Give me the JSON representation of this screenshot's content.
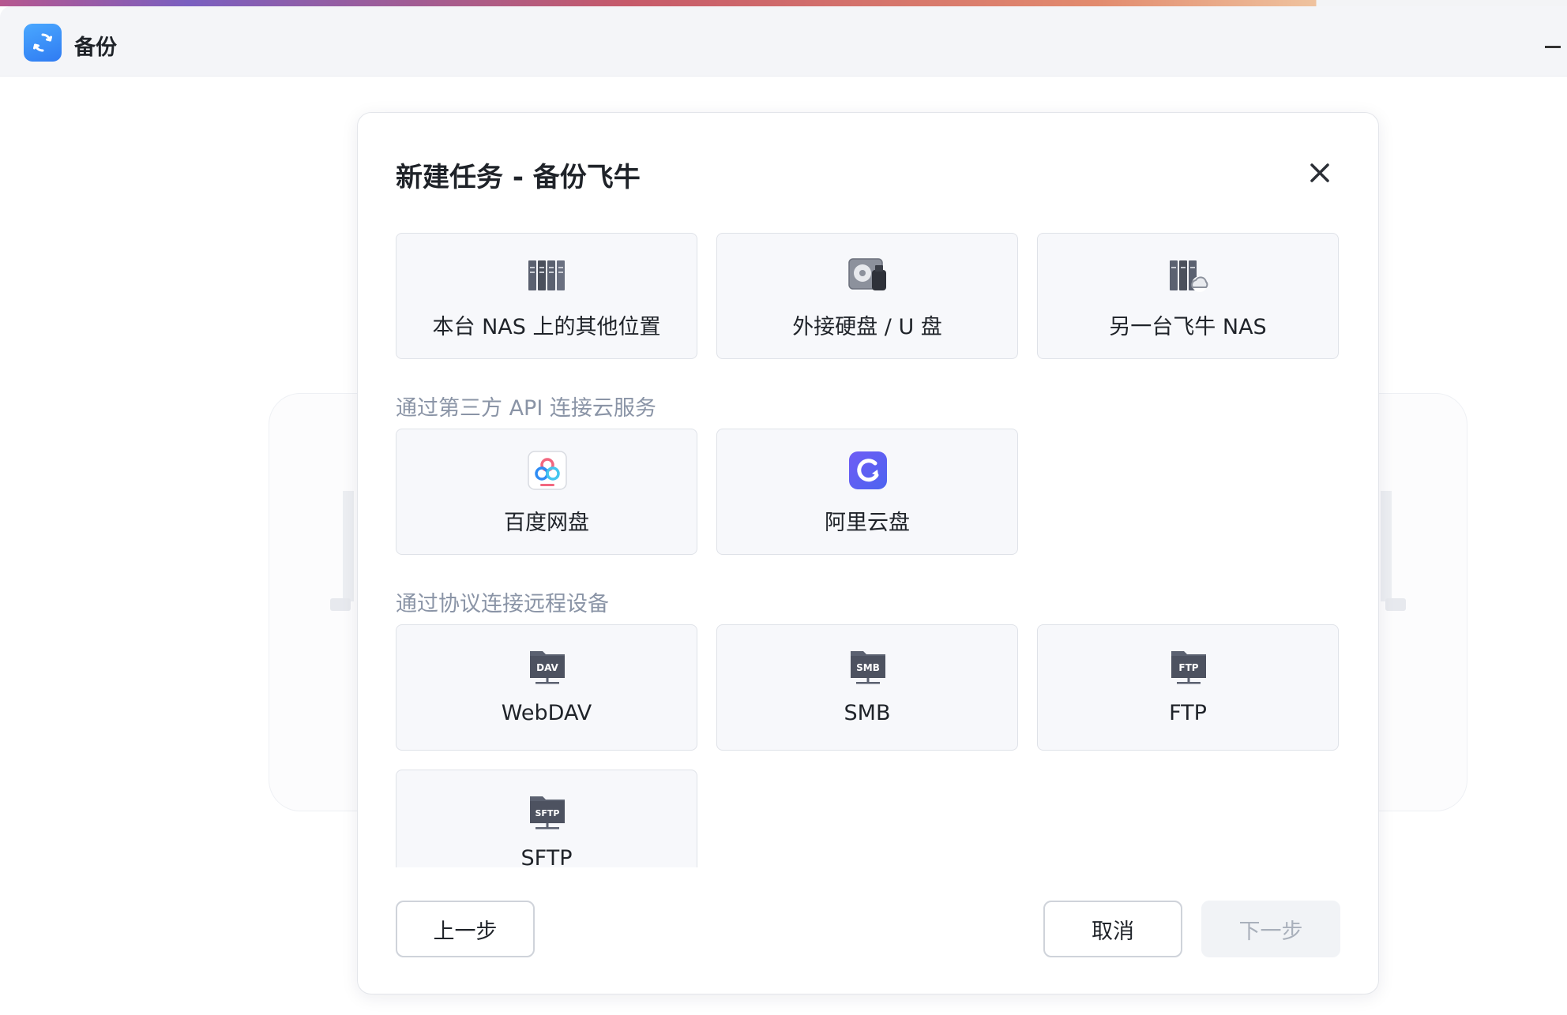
{
  "window": {
    "app_title": "备份",
    "app_icon": "sync-icon",
    "accent_color": "#2f7bf2"
  },
  "dialog": {
    "title": "新建任务 - 备份飞牛",
    "close_icon": "close-icon",
    "local_options": [
      {
        "label": "本台 NAS 上的其他位置",
        "icon": "server-rack-icon"
      },
      {
        "label": "外接硬盘 / U 盘",
        "icon": "usb-drive-icon"
      },
      {
        "label": "另一台飞牛 NAS",
        "icon": "server-cloud-icon"
      }
    ],
    "cloud_section_label": "通过第三方 API 连接云服务",
    "cloud_options": [
      {
        "label": "百度网盘",
        "icon": "baidu-netdisk-icon"
      },
      {
        "label": "阿里云盘",
        "icon": "aliyun-drive-icon"
      }
    ],
    "protocol_section_label": "通过协议连接远程设备",
    "protocol_options": [
      {
        "label": "WebDAV",
        "icon": "network-folder-icon",
        "badge": "DAV"
      },
      {
        "label": "SMB",
        "icon": "network-folder-icon",
        "badge": "SMB"
      },
      {
        "label": "FTP",
        "icon": "network-folder-icon",
        "badge": "FTP"
      },
      {
        "label": "SFTP",
        "icon": "network-folder-icon",
        "badge": "SFTP"
      }
    ],
    "footer": {
      "prev_label": "上一步",
      "cancel_label": "取消",
      "next_label": "下一步"
    }
  }
}
